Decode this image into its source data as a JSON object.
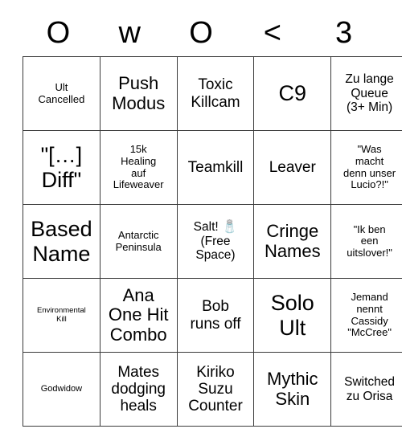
{
  "card": {
    "header_letters": [
      "O",
      "w",
      "O",
      "<",
      "3"
    ],
    "size": {
      "columns": 5,
      "rows": 5
    },
    "colors": {
      "background": "#ffffff",
      "text": "#000000",
      "border": "#3a3a3a"
    },
    "rows": [
      [
        {
          "text": "Ult\nCancelled",
          "size": "sm"
        },
        {
          "text": "Push\nModus",
          "size": "xl"
        },
        {
          "text": "Toxic\nKillcam",
          "size": "lg"
        },
        {
          "text": "C9",
          "size": "xxl"
        },
        {
          "text": "Zu lange\nQueue\n(3+ Min)",
          "size": "md"
        }
      ],
      [
        {
          "text": "\"[…]\nDiff\"",
          "size": "xxl"
        },
        {
          "text": "15k\nHealing\nauf\nLifeweaver",
          "size": "sm"
        },
        {
          "text": "Teamkill",
          "size": "lg"
        },
        {
          "text": "Leaver",
          "size": "lg"
        },
        {
          "text": "\"Was\nmacht\ndenn unser\nLucio?!\"",
          "size": "sm"
        }
      ],
      [
        {
          "text": "Based\nName",
          "size": "xxl"
        },
        {
          "text": "Antarctic\nPeninsula",
          "size": "sm"
        },
        {
          "text": "Salt! 🧂\n(Free\nSpace)",
          "size": "md"
        },
        {
          "text": "Cringe\nNames",
          "size": "xl"
        },
        {
          "text": "\"Ik ben\neen\nuitslover!\"",
          "size": "sm"
        }
      ],
      [
        {
          "text": "Environmental\nKill",
          "size": "xxs"
        },
        {
          "text": "Ana\nOne Hit\nCombo",
          "size": "xl"
        },
        {
          "text": "Bob\nruns off",
          "size": "lg"
        },
        {
          "text": "Solo\nUlt",
          "size": "xxl"
        },
        {
          "text": "Jemand\nnennt\nCassidy\n\"McCree\"",
          "size": "sm"
        }
      ],
      [
        {
          "text": "Godwidow",
          "size": "xs"
        },
        {
          "text": "Mates\ndodging\nheals",
          "size": "lg"
        },
        {
          "text": "Kiriko\nSuzu\nCounter",
          "size": "lg"
        },
        {
          "text": "Mythic\nSkin",
          "size": "xl"
        },
        {
          "text": "Switched\nzu Orisa",
          "size": "md"
        }
      ]
    ]
  }
}
